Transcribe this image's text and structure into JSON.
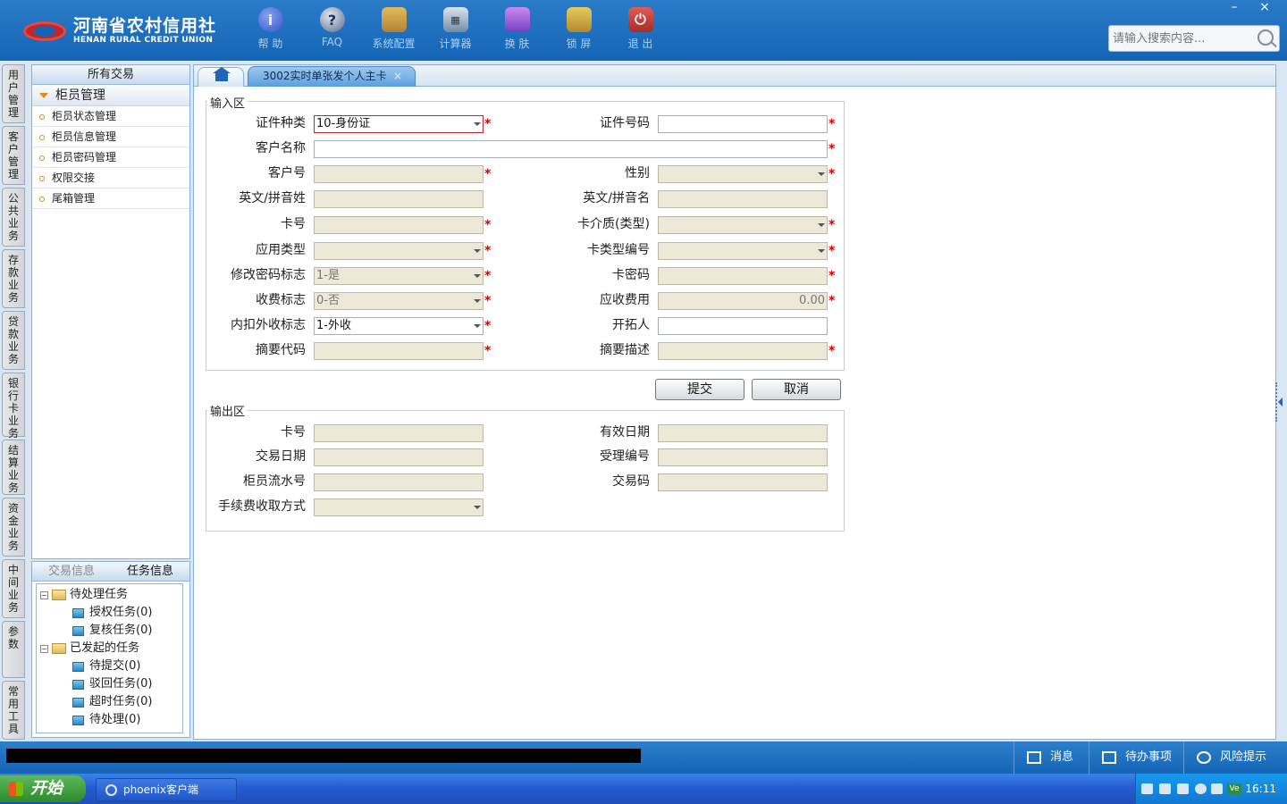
{
  "window": {
    "min_label": "–",
    "close_label": "×"
  },
  "brand": {
    "name_cn": "河南省农村信用社",
    "name_en": "HENAN RURAL CREDIT UNION"
  },
  "toolbar": [
    {
      "label": "帮 助",
      "icon": "info-icon",
      "glyph": "i"
    },
    {
      "label": "FAQ",
      "icon": "question-icon",
      "glyph": "?"
    },
    {
      "label": "系统配置",
      "icon": "toolbox-icon",
      "glyph": ""
    },
    {
      "label": "计算器",
      "icon": "calculator-icon",
      "glyph": "▦"
    },
    {
      "label": "换 肤",
      "icon": "shirt-icon",
      "glyph": ""
    },
    {
      "label": "锁 屏",
      "icon": "lock-icon",
      "glyph": ""
    },
    {
      "label": "退 出",
      "icon": "power-icon",
      "glyph": "⏻"
    }
  ],
  "search": {
    "placeholder": "请输入搜索内容..."
  },
  "vtabs": [
    "用户管理",
    "客户管理",
    "公共业务",
    "存款业务",
    "贷款业务",
    "银行卡业务",
    "结算业务",
    "资金业务",
    "中间业务",
    "参数",
    "常用工具"
  ],
  "menu": {
    "header": "所有交易",
    "group": "柜员管理",
    "items": [
      "柜员状态管理",
      "柜员信息管理",
      "柜员密码管理",
      "权限交接",
      "尾箱管理"
    ]
  },
  "taskpanel": {
    "tabs": [
      "交易信息",
      "任务信息"
    ],
    "pending": "待处理任务",
    "pending_children": [
      "授权任务(0)",
      "复核任务(0)"
    ],
    "initiated": "已发起的任务",
    "initiated_children": [
      "待提交(0)",
      "驳回任务(0)",
      "超时任务(0)",
      "待处理(0)"
    ]
  },
  "tabs": {
    "active": "3002实时单张发个人主卡",
    "close": "×"
  },
  "input_section": {
    "legend": "输入区",
    "id_type_label": "证件种类",
    "id_type_value": "10-身份证",
    "id_number_label": "证件号码",
    "id_number_value": "",
    "customer_name_label": "客户名称",
    "customer_name_value": "",
    "customer_no_label": "客户号",
    "customer_no_value": "",
    "gender_label": "性别",
    "gender_value": "",
    "en_surname_label": "英文/拼音姓",
    "en_surname_value": "",
    "en_name_label": "英文/拼音名",
    "en_name_value": "",
    "card_no_label": "卡号",
    "card_no_value": "",
    "card_medium_label": "卡介质(类型)",
    "card_medium_value": "",
    "app_type_label": "应用类型",
    "app_type_value": "",
    "card_type_code_label": "卡类型编号",
    "card_type_code_value": "",
    "change_pwd_label": "修改密码标志",
    "change_pwd_value": "1-是",
    "card_pwd_label": "卡密码",
    "card_pwd_value": "",
    "fee_flag_label": "收费标志",
    "fee_flag_value": "0-否",
    "fee_due_label": "应收费用",
    "fee_due_value": "0.00",
    "fee_mode_label": "内扣外收标志",
    "fee_mode_value": "1-外收",
    "developer_label": "开拓人",
    "developer_value": "",
    "summary_code_label": "摘要代码",
    "summary_code_value": "",
    "summary_desc_label": "摘要描述",
    "summary_desc_value": ""
  },
  "buttons": {
    "submit": "提交",
    "cancel": "取消"
  },
  "output_section": {
    "legend": "输出区",
    "card_no_label": "卡号",
    "card_no_value": "",
    "valid_date_label": "有效日期",
    "valid_date_value": "",
    "trade_date_label": "交易日期",
    "trade_date_value": "",
    "accept_no_label": "受理编号",
    "accept_no_value": "",
    "teller_serial_label": "柜员流水号",
    "teller_serial_value": "",
    "trade_code_label": "交易码",
    "trade_code_value": "",
    "fee_method_label": "手续费收取方式",
    "fee_method_value": ""
  },
  "required_mark": "*",
  "statusbar": {
    "messages": "消息",
    "todo": "待办事项",
    "risk": "风险提示"
  },
  "taskbar": {
    "start": "开始",
    "app": "phoenix客户端",
    "clock": "16:11",
    "tray_ve": "Ve"
  }
}
